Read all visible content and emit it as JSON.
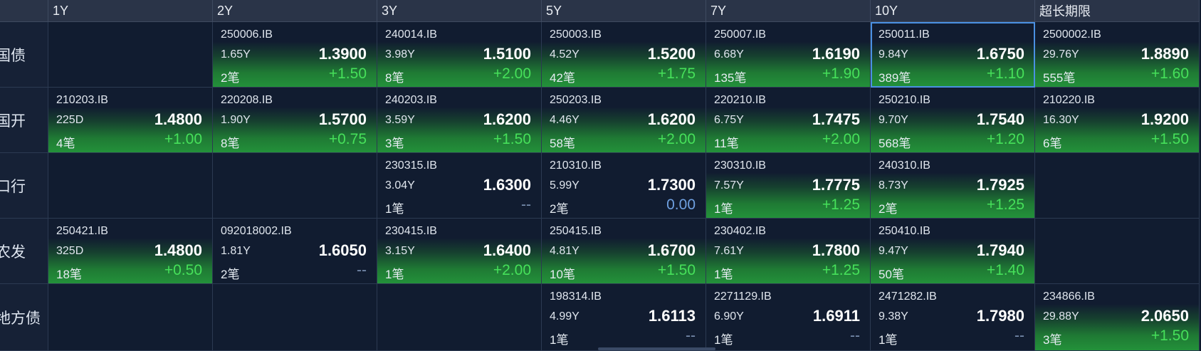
{
  "header": [
    "",
    "1Y",
    "2Y",
    "3Y",
    "5Y",
    "7Y",
    "10Y",
    "超长期限"
  ],
  "rows": [
    {
      "label": "国债",
      "cells": [
        null,
        {
          "code": "250006.IB",
          "term": "1.65Y",
          "rate": "1.3900",
          "count": "2笔",
          "change": "+1.50",
          "trend": "up"
        },
        {
          "code": "240014.IB",
          "term": "3.98Y",
          "rate": "1.5100",
          "count": "8笔",
          "change": "+2.00",
          "trend": "up"
        },
        {
          "code": "250003.IB",
          "term": "4.52Y",
          "rate": "1.5200",
          "count": "42笔",
          "change": "+1.75",
          "trend": "up"
        },
        {
          "code": "250007.IB",
          "term": "6.68Y",
          "rate": "1.6190",
          "count": "135笔",
          "change": "+1.90",
          "trend": "up"
        },
        {
          "code": "250011.IB",
          "term": "9.84Y",
          "rate": "1.6750",
          "count": "389笔",
          "change": "+1.10",
          "trend": "up",
          "selected": true
        },
        {
          "code": "2500002.IB",
          "term": "29.76Y",
          "rate": "1.8890",
          "count": "555笔",
          "change": "+1.60",
          "trend": "up"
        }
      ]
    },
    {
      "label": "国开",
      "cells": [
        {
          "code": "210203.IB",
          "term": "225D",
          "rate": "1.4800",
          "count": "4笔",
          "change": "+1.00",
          "trend": "up"
        },
        {
          "code": "220208.IB",
          "term": "1.90Y",
          "rate": "1.5700",
          "count": "8笔",
          "change": "+0.75",
          "trend": "up"
        },
        {
          "code": "240203.IB",
          "term": "3.59Y",
          "rate": "1.6200",
          "count": "3笔",
          "change": "+1.50",
          "trend": "up"
        },
        {
          "code": "250203.IB",
          "term": "4.46Y",
          "rate": "1.6200",
          "count": "58笔",
          "change": "+2.00",
          "trend": "up"
        },
        {
          "code": "220210.IB",
          "term": "6.75Y",
          "rate": "1.7475",
          "count": "11笔",
          "change": "+2.00",
          "trend": "up"
        },
        {
          "code": "250210.IB",
          "term": "9.70Y",
          "rate": "1.7540",
          "count": "568笔",
          "change": "+1.20",
          "trend": "up"
        },
        {
          "code": "210220.IB",
          "term": "16.30Y",
          "rate": "1.9200",
          "count": "6笔",
          "change": "+1.50",
          "trend": "up"
        }
      ]
    },
    {
      "label": "口行",
      "cells": [
        null,
        null,
        {
          "code": "230315.IB",
          "term": "3.04Y",
          "rate": "1.6300",
          "count": "1笔",
          "change": "--",
          "trend": "none"
        },
        {
          "code": "210310.IB",
          "term": "5.99Y",
          "rate": "1.7300",
          "count": "2笔",
          "change": "0.00",
          "trend": "flat"
        },
        {
          "code": "230310.IB",
          "term": "7.57Y",
          "rate": "1.7775",
          "count": "1笔",
          "change": "+1.25",
          "trend": "up"
        },
        {
          "code": "240310.IB",
          "term": "8.73Y",
          "rate": "1.7925",
          "count": "2笔",
          "change": "+1.25",
          "trend": "up"
        },
        null
      ]
    },
    {
      "label": "农发",
      "cells": [
        {
          "code": "250421.IB",
          "term": "325D",
          "rate": "1.4800",
          "count": "18笔",
          "change": "+0.50",
          "trend": "up"
        },
        {
          "code": "092018002.IB",
          "term": "1.81Y",
          "rate": "1.6050",
          "count": "2笔",
          "change": "--",
          "trend": "none"
        },
        {
          "code": "230415.IB",
          "term": "3.15Y",
          "rate": "1.6400",
          "count": "1笔",
          "change": "+2.00",
          "trend": "up"
        },
        {
          "code": "250415.IB",
          "term": "4.81Y",
          "rate": "1.6700",
          "count": "10笔",
          "change": "+1.50",
          "trend": "up"
        },
        {
          "code": "230402.IB",
          "term": "7.61Y",
          "rate": "1.7800",
          "count": "1笔",
          "change": "+1.25",
          "trend": "up"
        },
        {
          "code": "250410.IB",
          "term": "9.47Y",
          "rate": "1.7940",
          "count": "50笔",
          "change": "+1.40",
          "trend": "up"
        },
        null
      ]
    },
    {
      "label": "地方债",
      "cells": [
        null,
        null,
        null,
        {
          "code": "198314.IB",
          "term": "4.99Y",
          "rate": "1.6113",
          "count": "1笔",
          "change": "--",
          "trend": "none"
        },
        {
          "code": "2271129.IB",
          "term": "6.90Y",
          "rate": "1.6911",
          "count": "1笔",
          "change": "--",
          "trend": "none"
        },
        {
          "code": "2471282.IB",
          "term": "9.38Y",
          "rate": "1.7980",
          "count": "1笔",
          "change": "--",
          "trend": "none"
        },
        {
          "code": "234866.IB",
          "term": "29.88Y",
          "rate": "2.0650",
          "count": "3笔",
          "change": "+1.50",
          "trend": "up"
        }
      ]
    }
  ]
}
